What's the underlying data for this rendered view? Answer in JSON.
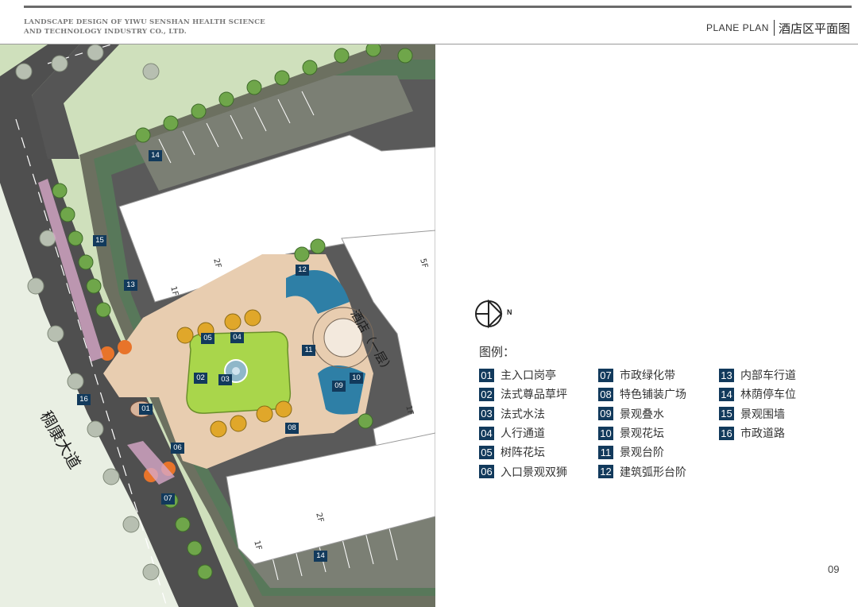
{
  "header": {
    "company_line1": "LANDSCAPE DESIGN OF YIWU SENSHAN HEALTH SCIENCE",
    "company_line2": "AND TECHNOLOGY INDUSTRY CO., LTD.",
    "plan_en": "PLANE PLAN",
    "plan_cn": "酒店区平面图"
  },
  "map": {
    "road_label": "稠康大道",
    "hotel_label": "酒店（一层）",
    "floor_labels": [
      "2F",
      "1F",
      "5F",
      "1F",
      "2F",
      "1F"
    ],
    "tags": [
      "14",
      "15",
      "13",
      "12",
      "05",
      "04",
      "11",
      "02",
      "03",
      "10",
      "09",
      "16",
      "01",
      "08",
      "06",
      "07",
      "14"
    ]
  },
  "legend": {
    "title": "图例：",
    "columns": [
      [
        {
          "num": "01",
          "label": "主入口岗亭"
        },
        {
          "num": "02",
          "label": "法式尊品草坪"
        },
        {
          "num": "03",
          "label": "法式水法"
        },
        {
          "num": "04",
          "label": "人行通道"
        },
        {
          "num": "05",
          "label": "树阵花坛"
        },
        {
          "num": "06",
          "label": "入口景观双狮"
        }
      ],
      [
        {
          "num": "07",
          "label": "市政绿化带"
        },
        {
          "num": "08",
          "label": "特色铺装广场"
        },
        {
          "num": "09",
          "label": "景观叠水"
        },
        {
          "num": "10",
          "label": "景观花坛"
        },
        {
          "num": "11",
          "label": "景观台阶"
        },
        {
          "num": "12",
          "label": "建筑弧形台阶"
        }
      ],
      [
        {
          "num": "13",
          "label": "内部车行道"
        },
        {
          "num": "14",
          "label": "林荫停车位"
        },
        {
          "num": "15",
          "label": "景观围墙"
        },
        {
          "num": "16",
          "label": "市政道路"
        }
      ]
    ]
  },
  "compass": {
    "letter": "N",
    "icon": "north-arrow-icon"
  },
  "page_number": "09",
  "colors": {
    "tag_bg": "#123a5c",
    "lawn": "#a9d64b",
    "road": "#4a4a4a",
    "plaza": "#e8cdb0",
    "water": "#2e7fa6"
  }
}
